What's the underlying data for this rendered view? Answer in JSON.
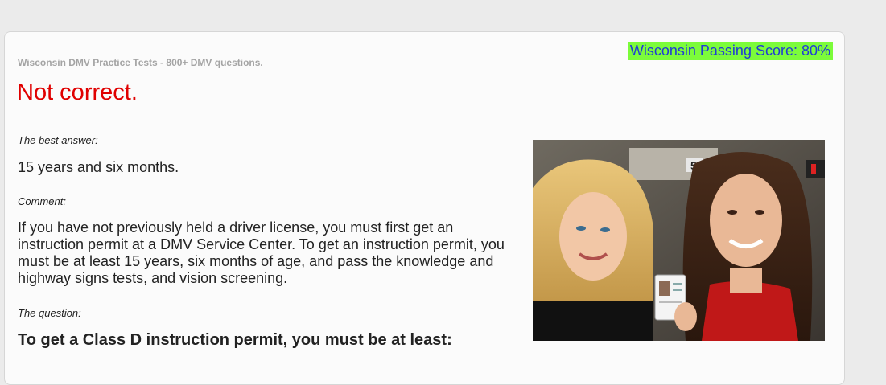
{
  "passing_score": "Wisconsin Passing Score: 80%",
  "site_title": "Wisconsin DMV Practice Tests - 800+ DMV questions.",
  "result": "Not correct.",
  "best_answer_label": "The best answer:",
  "best_answer": "15 years and six months.",
  "comment_label": "Comment:",
  "comment": "If you have not previously held a driver license, you must first get an instruction permit at a DMV Service Center. To get an instruction permit, you must be at least 15 years, six months of age, and pass the knowledge and highway signs tests, and vision screening.",
  "question_label": "The question:",
  "question": "To get a Class D instruction permit, you must be at least:",
  "colors": {
    "badge_bg": "#7cfc3a",
    "badge_text": "#1f3bd6",
    "result_text": "#e00000"
  }
}
